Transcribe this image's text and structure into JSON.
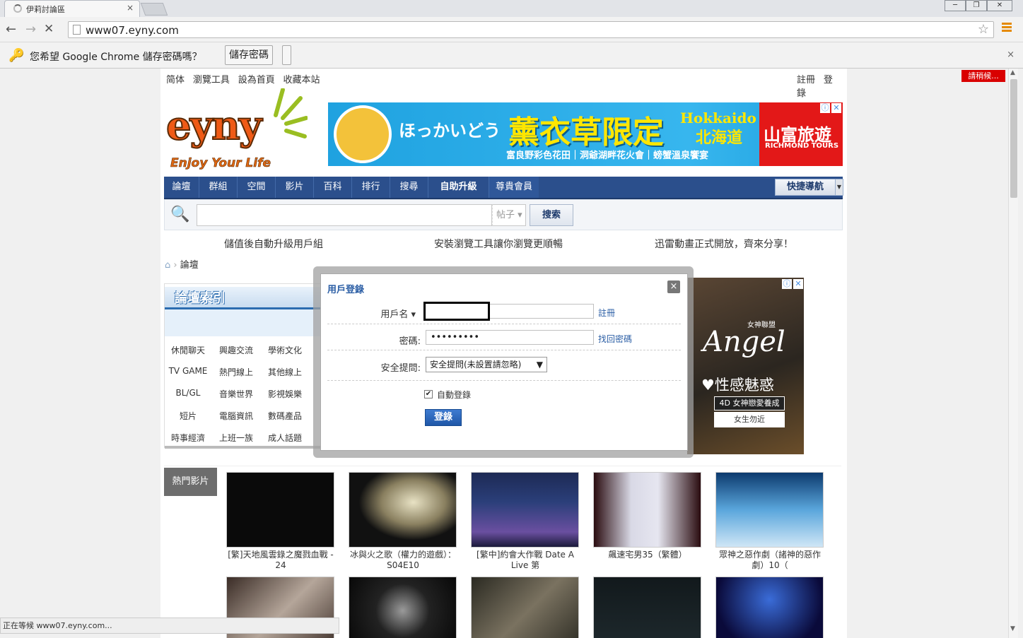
{
  "browser": {
    "tab_title": "伊莉討論區",
    "tab_close": "×",
    "url": "www07.eyny.com",
    "infobar_message": "您希望 Google Chrome 儲存密碼嗎？",
    "infobar_save_label": "儲存密碼",
    "infobar_close": "×",
    "status_text": "正在等候 www07.eyny.com..."
  },
  "site": {
    "top_left_links": [
      "简体",
      "瀏覽工具",
      "設為首頁",
      "收藏本站"
    ],
    "top_right_links": [
      "註冊",
      "登錄"
    ],
    "loading_badge": "請稍候...",
    "logo_text": "eyny",
    "logo_slogan": "Enjoy Your Life",
    "banner": {
      "jp_text": "ほっかいどう",
      "headline": "薰衣草限定",
      "hokkaido_en": "Hokkaido",
      "hokkaido_zh": "北海道",
      "subline": "富良野彩色花田｜洞爺湖畔花火會｜螃蟹溫泉饗宴",
      "brand_zh": "山富旅遊",
      "brand_en": "RICHMOND TOURS"
    },
    "nav_items": [
      "論壇",
      "群組",
      "空間",
      "影片",
      "百科",
      "排行",
      "搜尋",
      "自助升級",
      "尊貴會員"
    ],
    "quick_nav": "快捷導航",
    "search": {
      "scope": "帖子",
      "button": "搜索"
    },
    "promos": [
      "儲值後自動升級用戶組",
      "安裝瀏覽工具讓你瀏覽更順暢",
      "迅雷動畫正式開放，齊來分享！"
    ],
    "breadcrumb": "論壇",
    "forum_index_title": "論壇索引",
    "forum_links": [
      [
        "休閒聊天",
        "興趣交流",
        "學術文化"
      ],
      [
        "TV GAME",
        "熱門線上",
        "其他線上"
      ],
      [
        "BL/GL",
        "音樂世界",
        "影視娛樂"
      ],
      [
        "短片",
        "電腦資訊",
        "數碼產品"
      ],
      [
        "時事經濟",
        "上班一族",
        "成人話題"
      ]
    ],
    "side_ad": {
      "tag": "女神聯盟",
      "title": "Angel",
      "headline": "♥性感魅惑",
      "badge1": "4D 女神戀愛養成",
      "badge2": "女生勿近"
    },
    "hot_videos_label": "熱門影片",
    "videos": [
      "[繁]天地風雲錄之魔戮血戰 - 24",
      "冰與火之歌（權力的遊戲）：S04E10",
      "[繁中]約會大作戰 Date A Live 第",
      "飆速宅男35（繁體）",
      "眾神之惡作劇（諸神的惡作劇）10（"
    ]
  },
  "login_modal": {
    "title": "用戶登錄",
    "close": "×",
    "username_label": "用戶名",
    "register_link": "註冊",
    "password_label": "密碼:",
    "password_value": "•••••••••",
    "forgot_link": "找回密碼",
    "security_label": "安全提問:",
    "security_value": "安全提問(未設置請忽略)",
    "auto_login_label": "自動登錄",
    "auto_login_checked": "✔",
    "login_button": "登錄"
  }
}
